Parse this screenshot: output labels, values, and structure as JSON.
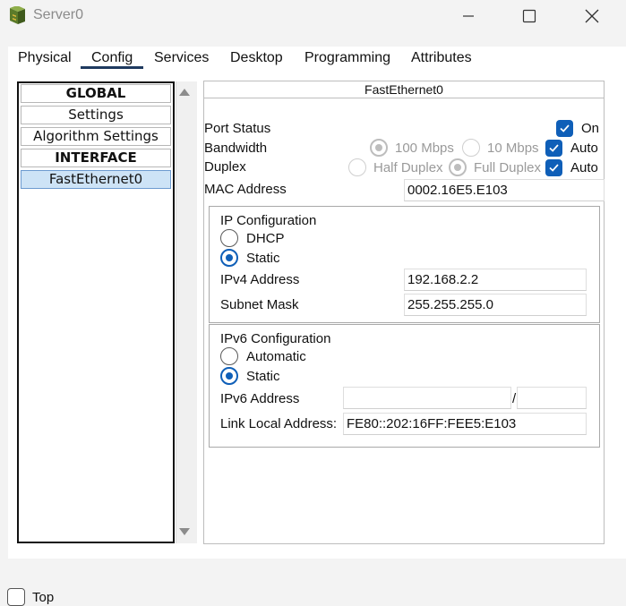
{
  "window": {
    "title": "Server0"
  },
  "tabs": [
    {
      "label": "Physical"
    },
    {
      "label": "Config"
    },
    {
      "label": "Services"
    },
    {
      "label": "Desktop"
    },
    {
      "label": "Programming"
    },
    {
      "label": "Attributes"
    }
  ],
  "sidebar": {
    "items": [
      {
        "label": "GLOBAL"
      },
      {
        "label": "Settings"
      },
      {
        "label": "Algorithm Settings"
      },
      {
        "label": "INTERFACE"
      },
      {
        "label": "FastEthernet0"
      }
    ]
  },
  "interface": {
    "title": "FastEthernet0",
    "port_status": {
      "label": "Port Status",
      "on_label": "On",
      "on_checked": true
    },
    "bandwidth": {
      "label": "Bandwidth",
      "opt1": "100 Mbps",
      "opt2": "10 Mbps",
      "auto_label": "Auto",
      "auto_checked": true
    },
    "duplex": {
      "label": "Duplex",
      "opt1": "Half Duplex",
      "opt2": "Full Duplex",
      "auto_label": "Auto",
      "auto_checked": true
    },
    "mac": {
      "label": "MAC Address",
      "value": "0002.16E5.E103"
    }
  },
  "ip_config": {
    "title": "IP Configuration",
    "dhcp_label": "DHCP",
    "static_label": "Static",
    "selected": "Static",
    "ipv4_label": "IPv4 Address",
    "ipv4_value": "192.168.2.2",
    "mask_label": "Subnet Mask",
    "mask_value": "255.255.255.0"
  },
  "ipv6_config": {
    "title": "IPv6 Configuration",
    "auto_label": "Automatic",
    "static_label": "Static",
    "selected": "Static",
    "ipv6_label": "IPv6 Address",
    "ipv6_value": "",
    "prefix_sep": "/",
    "prefix_value": "",
    "link_local_label": "Link Local Address:",
    "link_local_value": "FE80::202:16FF:FEE5:E103"
  },
  "footer": {
    "checkbox_label": "Top"
  },
  "colors": {
    "accent": "#0f5fb8",
    "tab_underline": "#1f3a5f",
    "selected_item": "#cde3f6"
  }
}
